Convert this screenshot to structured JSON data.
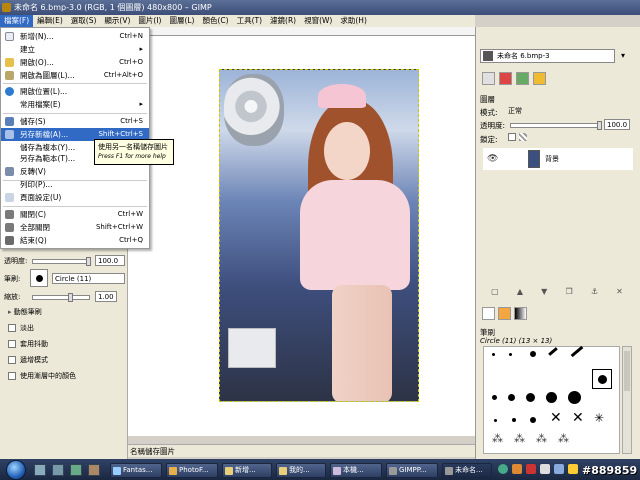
{
  "window": {
    "title": "未命名 6.bmp-3.0 (RGB, 1 個圖層) 480x800 – GIMP"
  },
  "menubar": [
    "檔案(F)",
    "編輯(E)",
    "選取(S)",
    "顯示(V)",
    "圖片(I)",
    "圖層(L)",
    "顏色(C)",
    "工具(T)",
    "濾鏡(R)",
    "視窗(W)",
    "求助(H)"
  ],
  "file_menu": {
    "items": [
      {
        "label": "新增(N)...",
        "shortcut": "Ctrl+N"
      },
      {
        "label": "建立",
        "shortcut": "▸"
      },
      {
        "label": "開啟(O)...",
        "shortcut": "Ctrl+O"
      },
      {
        "label": "開啟為圖層(L)...",
        "shortcut": "Ctrl+Alt+O"
      },
      {
        "label": "開啟位置(L)...",
        "shortcut": ""
      },
      {
        "label": "常用檔案(E)",
        "shortcut": "▸"
      },
      {
        "label": "儲存(S)",
        "shortcut": "Ctrl+S"
      },
      {
        "label": "另存新檔(A)...",
        "shortcut": "Shift+Ctrl+S"
      },
      {
        "label": "儲存為複本(Y)...",
        "shortcut": ""
      },
      {
        "label": "另存為範本(T)...",
        "shortcut": ""
      },
      {
        "label": "反轉(V)",
        "shortcut": ""
      },
      {
        "label": "列印(P)...",
        "shortcut": ""
      },
      {
        "label": "頁面設定(U)",
        "shortcut": ""
      },
      {
        "label": "關閉(C)",
        "shortcut": "Ctrl+W"
      },
      {
        "label": "全部關閉",
        "shortcut": "Shift+Ctrl+W"
      },
      {
        "label": "結束(Q)",
        "shortcut": "Ctrl+Q"
      }
    ]
  },
  "tooltip": {
    "text": "使用另一名稱儲存圖片",
    "hint": "Press F1 for more help"
  },
  "tool_options": {
    "opacity_label": "透明度:",
    "opacity_value": "100.0",
    "opacity_level": 1.0,
    "brush_label": "筆刷:",
    "brush_value": "Circle (11)",
    "scale_label": "縮放:",
    "scale_value": "1.00",
    "scale_level": 0.4,
    "dynamics_label": "動態筆刷",
    "checks": [
      "淡出",
      "套用抖動",
      "遞增模式",
      "使用漸層中的顏色"
    ]
  },
  "statusbar": {
    "text": "名稱儲存圖片"
  },
  "dock": {
    "image_selector": "未命名 6.bmp-3",
    "layers_title": "圖層",
    "mode_label": "模式:",
    "mode_value": "正常",
    "opacity_label": "透明度:",
    "opacity_value": "100.0",
    "lock_label": "鎖定:",
    "layer_name": "背景",
    "brushes_title": "筆刷",
    "brush_caption": "Circle (11) (13 × 13)"
  },
  "taskbar": {
    "items": [
      "Fantas...",
      "PhotoF...",
      "新增...",
      "我的...",
      "本機...",
      "GIMPP...",
      "未命名..."
    ]
  },
  "watermark": "#889859"
}
